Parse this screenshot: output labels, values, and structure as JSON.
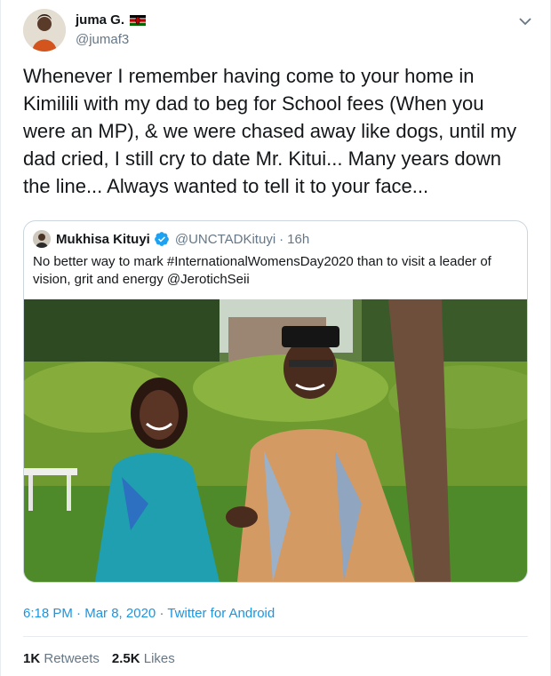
{
  "tweet": {
    "display_name": "juma G.",
    "handle": "@jumaf3",
    "text": "Whenever I remember having come to your home in Kimilili with my dad to beg for School fees (When you were an MP), & we were chased away like dogs, until my dad cried, I still cry to date Mr. Kitui... Many years down the line... Always wanted to tell it to your face...",
    "time": "6:18 PM",
    "date": "Mar 8, 2020",
    "source": "Twitter for Android",
    "separator": "·",
    "retweets_count": "1K",
    "retweets_label": "Retweets",
    "likes_count": "2.5K",
    "likes_label": "Likes",
    "icons": {
      "menu": "chevron-down-icon",
      "flag": "kenya-flag-icon"
    }
  },
  "quoted": {
    "display_name": "Mukhisa Kituyi",
    "handle": "@UNCTADKituyi",
    "separator": "·",
    "time": "16h",
    "text": "No better way to mark #InternationalWomensDay2020 than to visit a leader of vision, grit and energy @JerotichSeii",
    "icons": {
      "verified": "verified-badge-icon"
    }
  },
  "colors": {
    "text": "#14171a",
    "secondary": "#657786",
    "link": "#1b95e0",
    "verified": "#1da1f2",
    "border": "#ccd6dd"
  }
}
